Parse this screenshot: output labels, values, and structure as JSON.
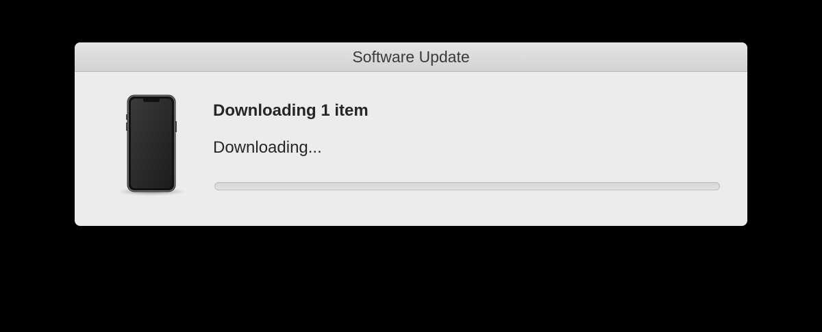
{
  "window": {
    "title": "Software Update"
  },
  "update": {
    "heading": "Downloading 1 item",
    "status": "Downloading...",
    "progress": 0,
    "device_icon": "iphone-icon"
  },
  "colors": {
    "background": "#000000",
    "window": "#ececec",
    "progress_track": "#d8d8d8",
    "progress_fill": "#2a7ff2"
  }
}
